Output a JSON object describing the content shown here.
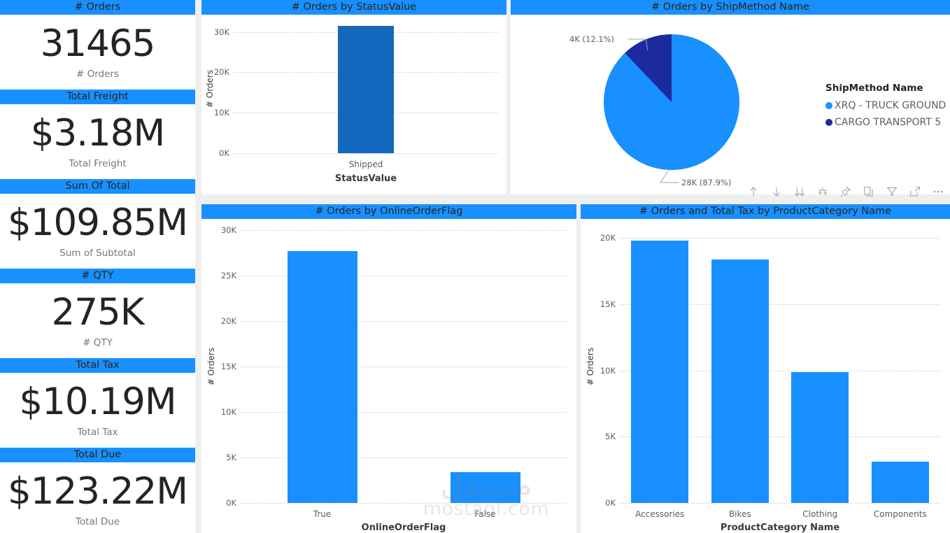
{
  "theme": {
    "accent": "#1890ff",
    "bar_light": "#1890ff",
    "bar_dark": "#1368be",
    "pie_light": "#1890ff",
    "pie_dark": "#1b2a9e",
    "page_bg": "#efefef",
    "panel_bg": "#ffffff",
    "label_gray": "#605e5c"
  },
  "kpis": [
    {
      "header": "# Orders",
      "value": "31465",
      "label": "# Orders"
    },
    {
      "header": "Total Freight",
      "value": "$3.18M",
      "label": "Total Freight"
    },
    {
      "header": "Sum Of Total",
      "value": "$109.85M",
      "label": "Sum of Subtotal"
    },
    {
      "header": "# QTY",
      "value": "275K",
      "label": "# QTY"
    },
    {
      "header": "Total Tax",
      "value": "$10.19M",
      "label": "Total Tax"
    },
    {
      "header": "Total Due",
      "value": "$123.22M",
      "label": "Total Due"
    }
  ],
  "panels": {
    "status": {
      "title": "# Orders by StatusValue"
    },
    "ship": {
      "title": "# Orders by ShipMethod Name"
    },
    "online": {
      "title": "# Orders by OnlineOrderFlag"
    },
    "category": {
      "title": "# Orders and Total Tax by ProductCategory Name"
    }
  },
  "legend": {
    "title": "ShipMethod Name",
    "items": [
      {
        "label": "XRQ - TRUCK GROUND",
        "color": "#1890ff"
      },
      {
        "label": "CARGO TRANSPORT 5",
        "color": "#1b2a9e"
      }
    ]
  },
  "toolbar": {
    "buttons": [
      {
        "name": "drill-up-icon",
        "title": "Drill up"
      },
      {
        "name": "drill-down-icon",
        "title": "Drill down"
      },
      {
        "name": "expand-all-icon",
        "title": "Expand all down one level in the hierarchy"
      },
      {
        "name": "drill-mode-icon",
        "title": "Go to the next level in the hierarchy"
      },
      {
        "name": "pin-icon",
        "title": "Pin visual"
      },
      {
        "name": "copy-icon",
        "title": "Copy visual"
      },
      {
        "name": "filter-icon",
        "title": "Filters"
      },
      {
        "name": "focus-mode-icon",
        "title": "Focus mode"
      },
      {
        "name": "more-options-icon",
        "title": "More options"
      }
    ]
  },
  "watermark": {
    "arabic": "مستقل",
    "latin": "mostaql.com"
  },
  "chart_data": [
    {
      "id": "status",
      "type": "bar",
      "title": "# Orders by StatusValue",
      "categories": [
        "Shipped"
      ],
      "values": [
        31465
      ],
      "xlabel": "StatusValue",
      "ylabel": "# Orders",
      "ylim": [
        0,
        32000
      ],
      "yticks": [
        "0K",
        "10K",
        "20K",
        "30K"
      ],
      "ytickvals": [
        0,
        10000,
        20000,
        30000
      ],
      "color": "#1368be",
      "grid": true
    },
    {
      "id": "ship",
      "type": "pie",
      "title": "# Orders by ShipMethod Name",
      "labels": [
        "XRQ - TRUCK GROUND",
        "CARGO TRANSPORT 5"
      ],
      "values": [
        28000,
        4000
      ],
      "percentages": [
        87.9,
        12.1
      ],
      "data_labels": [
        "28K (87.9%)",
        "4K (12.1%)"
      ],
      "colors": [
        "#1890ff",
        "#1b2a9e"
      ],
      "legend_position": "right",
      "legend_title": "ShipMethod Name"
    },
    {
      "id": "online",
      "type": "bar",
      "title": "# Orders by OnlineOrderFlag",
      "categories": [
        "True",
        "False"
      ],
      "values": [
        27659,
        3406
      ],
      "xlabel": "OnlineOrderFlag",
      "ylabel": "# Orders",
      "ylim": [
        0,
        30000
      ],
      "yticks": [
        "0K",
        "5K",
        "10K",
        "15K",
        "20K",
        "25K",
        "30K"
      ],
      "ytickvals": [
        0,
        5000,
        10000,
        15000,
        20000,
        25000,
        30000
      ],
      "color": "#1890ff",
      "grid": true
    },
    {
      "id": "category",
      "type": "bar",
      "title": "# Orders and Total Tax by ProductCategory Name",
      "categories": [
        "Accessories",
        "Bikes",
        "Clothing",
        "Components"
      ],
      "values": [
        19800,
        18400,
        9900,
        3100
      ],
      "xlabel": "ProductCategory Name",
      "ylabel": "# Orders",
      "ylim": [
        0,
        20600
      ],
      "yticks": [
        "0K",
        "5K",
        "10K",
        "15K",
        "20K"
      ],
      "ytickvals": [
        0,
        5000,
        10000,
        15000,
        20000
      ],
      "color": "#1890ff",
      "grid": true
    }
  ]
}
